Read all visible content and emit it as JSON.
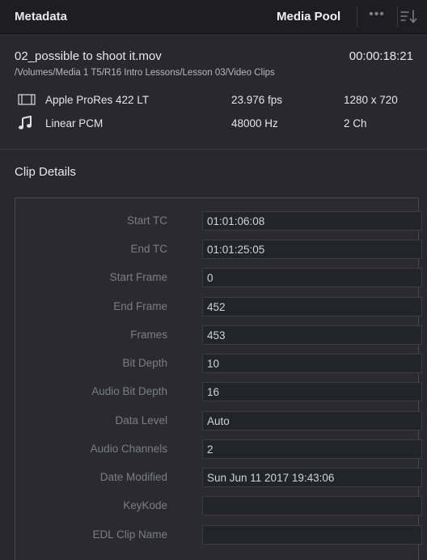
{
  "header": {
    "title": "Metadata",
    "media_pool_label": "Media Pool",
    "more_label": "•••"
  },
  "file": {
    "name": "02_possible to shoot it.mov",
    "timecode": "00:00:18:21",
    "path": "/Volumes/Media 1 T5/R16 Intro Lessons/Lesson 03/Video Clips"
  },
  "video": {
    "icon": "film-icon",
    "codec": "Apple ProRes 422 LT",
    "fps": "23.976 fps",
    "resolution": "1280 x 720"
  },
  "audio": {
    "icon": "music-note-icon",
    "codec": "Linear PCM",
    "sample_rate": "48000 Hz",
    "channels": "2 Ch"
  },
  "clip_details": {
    "title": "Clip Details",
    "fields": [
      {
        "label": "Start TC",
        "value": "01:01:06:08"
      },
      {
        "label": "End TC",
        "value": "01:01:25:05"
      },
      {
        "label": "Start Frame",
        "value": "0"
      },
      {
        "label": "End Frame",
        "value": "452"
      },
      {
        "label": "Frames",
        "value": "453"
      },
      {
        "label": "Bit Depth",
        "value": "10"
      },
      {
        "label": "Audio Bit Depth",
        "value": "16"
      },
      {
        "label": "Data Level",
        "value": "Auto"
      },
      {
        "label": "Audio Channels",
        "value": "2"
      },
      {
        "label": "Date Modified",
        "value": "Sun Jun 11 2017 19:43:06"
      },
      {
        "label": "KeyKode",
        "value": ""
      },
      {
        "label": "EDL Clip Name",
        "value": ""
      }
    ]
  }
}
